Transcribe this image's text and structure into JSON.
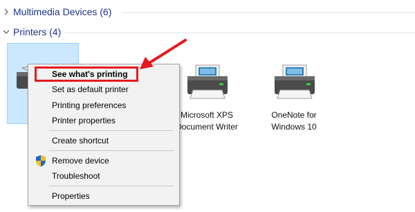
{
  "groups": [
    {
      "label": "Multimedia Devices (6)",
      "expanded": false
    },
    {
      "label": "Printers (4)",
      "expanded": true
    }
  ],
  "printers": [
    {
      "label_line1": "",
      "label_line2": "",
      "selected": true
    },
    {
      "label_line1": "",
      "label_line2": "",
      "selected": false
    },
    {
      "label_line1": "Microsoft XPS",
      "label_line2": "Document Writer",
      "selected": false
    },
    {
      "label_line1": "OneNote for",
      "label_line2": "Windows 10",
      "selected": false
    }
  ],
  "context_menu": {
    "items": [
      {
        "label": "See what's printing",
        "bold": true
      },
      {
        "label": "Set as default printer"
      },
      {
        "label": "Printing preferences"
      },
      {
        "label": "Printer properties"
      },
      {
        "label": "Create shortcut"
      },
      {
        "label": "Remove device",
        "icon": "uac-shield-icon"
      },
      {
        "label": "Troubleshoot"
      },
      {
        "label": "Properties"
      }
    ]
  },
  "colors": {
    "group_header": "#1e3287",
    "annotation_red": "#e5191c",
    "selection_fill": "#cce8ff"
  }
}
